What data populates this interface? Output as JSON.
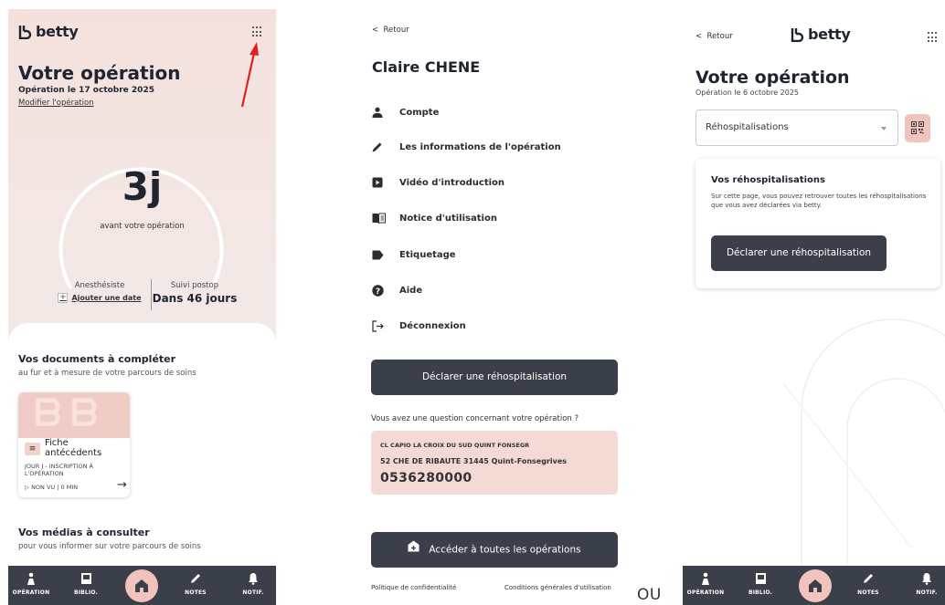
{
  "brand": {
    "name": "betty",
    "accent": "#f0c4bd",
    "dark": "#3a3f49"
  },
  "panel1": {
    "title": "Votre opération",
    "date": "Opération le 17 octobre 2025",
    "modify_link": "Modifier l'opération",
    "countdown_value": "3j",
    "countdown_label": "avant votre opération",
    "anesthesiste_label": "Anesthésiste",
    "add_date": "Ajouter une date",
    "postop_label": "Suivi postop",
    "postop_value": "Dans 46 jours",
    "docs_title": "Vos documents à compléter",
    "docs_subtitle": "au fur et à mesure de votre parcours de soins",
    "doc_card": {
      "name": "Fiche antécédents",
      "step": "JOUR J - INSCRIPTION À L'OPÉRATION",
      "status": "▷ NON VU",
      "duration": "0 MIN",
      "tag": "≡"
    },
    "media_title": "Vos médias à consulter",
    "media_subtitle": "pour vous informer sur votre parcours de soins"
  },
  "nav": {
    "operation": "OPÉRATION",
    "biblio": "BIBLIO.",
    "notes": "NOTES",
    "notif": "NOTIF."
  },
  "panel2": {
    "back": "Retour",
    "person": "Claire CHENE",
    "menu": [
      {
        "label": "Compte",
        "icon": "person-icon"
      },
      {
        "label": "Les informations de l'opération",
        "icon": "pencil-icon"
      },
      {
        "label": "Vidéo d'introduction",
        "icon": "play-icon"
      },
      {
        "label": "Notice d'utilisation",
        "icon": "book-icon"
      },
      {
        "label": "Etiquetage",
        "icon": "label-icon"
      },
      {
        "label": "Aide",
        "icon": "help-icon"
      },
      {
        "label": "Déconnexion",
        "icon": "logout-icon"
      }
    ],
    "declare_button": "Déclarer une réhospitalisation",
    "question": "Vous avez une question concernant votre opération ?",
    "clinic_name": "CL CAPIO LA CROIX DU SUD QUINT FONSEGR",
    "clinic_address": "52 CHE DE RIBAUTE 31445 Quint-Fonsegrives",
    "clinic_phone": "0536280000",
    "all_ops_button": "Accéder à toutes les opérations",
    "privacy": "Politique de confidentialité",
    "cgu": "Conditions générales d'utilisation"
  },
  "separator": "OU",
  "panel3": {
    "back": "Retour",
    "title": "Votre opération",
    "date": "Opération le 6 octobre 2025",
    "select_value": "Réhospitalisations",
    "card_title": "Vos réhospitalisations",
    "card_desc": "Sur cette page, vous pouvez retrouver toutes les réhospitalisations que vous avez déclarées via betty.",
    "declare_button": "Déclarer une réhospitalisation"
  }
}
